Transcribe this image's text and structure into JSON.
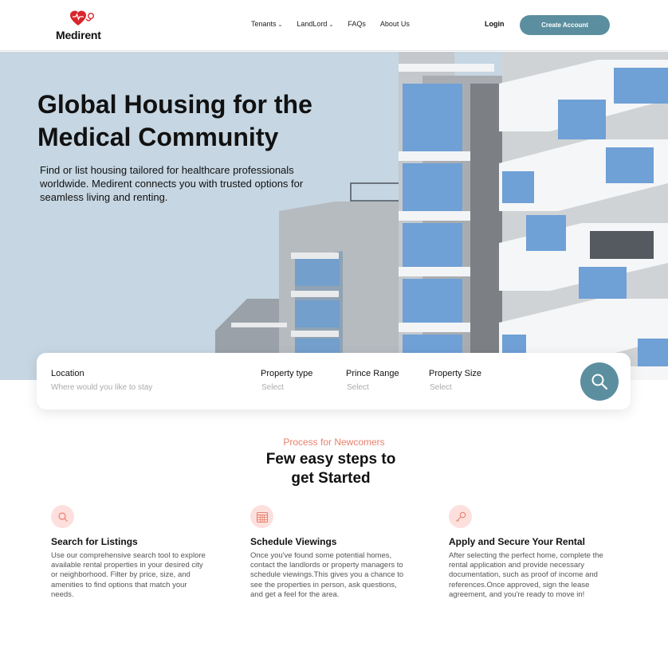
{
  "brand": {
    "name": "Medirent",
    "accent": "#5b8fa0",
    "logo_heart": "#d7262c"
  },
  "nav": {
    "items": [
      {
        "label": "Tenants",
        "dropdown": true
      },
      {
        "label": "LandLord",
        "dropdown": true
      },
      {
        "label": "FAQs",
        "dropdown": false
      },
      {
        "label": "About Us",
        "dropdown": false
      }
    ],
    "login": "Login",
    "create_account": "Create Account"
  },
  "hero": {
    "title_line1": "Global Housing for the",
    "title_line2": "Medical Community",
    "description": "Find or list housing tailored for healthcare professionals worldwide. Medirent connects you with trusted options for seamless living and renting."
  },
  "search": {
    "location": {
      "label": "Location",
      "placeholder": "Where would you like to stay"
    },
    "property_type": {
      "label": "Property type",
      "value": "Select"
    },
    "price_range": {
      "label": "Prince Range",
      "value": "Select"
    },
    "property_size": {
      "label": "Property Size",
      "value": "Select"
    }
  },
  "process": {
    "subtitle": "Process for Newcomers",
    "title_line1": "Few easy steps to",
    "title_line2": "get Started",
    "steps": [
      {
        "icon": "search-icon",
        "title": "Search for Listings",
        "text": "Use our comprehensive search tool to explore available rental properties in your desired city or neighborhood. Filter by price, size, and amenities to find options that match your needs."
      },
      {
        "icon": "calendar-icon",
        "title": "Schedule Viewings",
        "text": "Once you've found some potential homes, contact the landlords or property managers to schedule viewings.This gives you a chance to see the properties in person, ask questions, and get a feel for the area."
      },
      {
        "icon": "key-icon",
        "title": "Apply and Secure Your Rental",
        "text": "After selecting the perfect home, complete the rental application and provide necessary documentation, such as proof of income and references.Once approved, sign the lease agreement, and you're ready to move in!"
      }
    ]
  }
}
